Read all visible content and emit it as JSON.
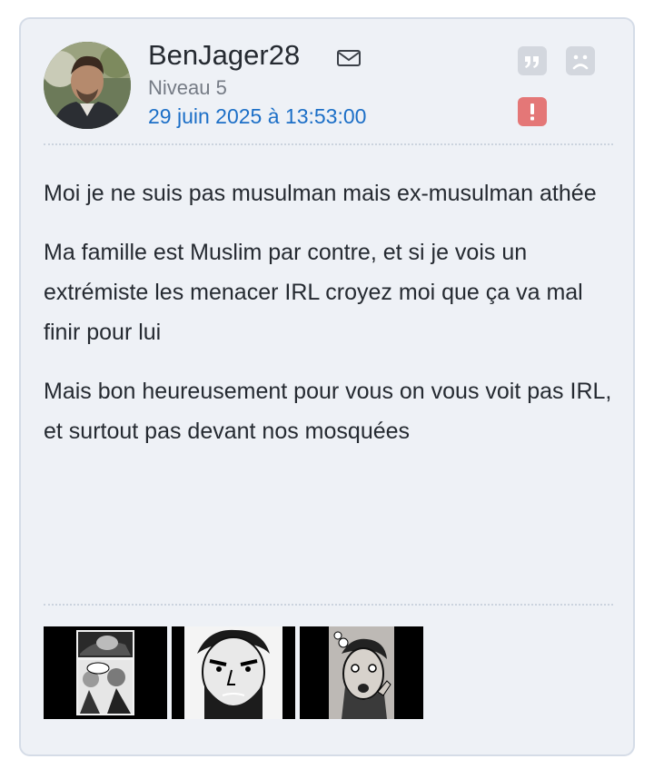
{
  "post": {
    "username": "BenJager28",
    "level": "Niveau 5",
    "date": "29 juin 2025 à 13:53:00",
    "icons": {
      "mail": "envelope-icon",
      "quote": "quote-icon",
      "dislike": "frown-icon",
      "report": "exclamation-icon"
    },
    "colors": {
      "card_background": "#eef1f6",
      "date_link": "#1c6fc7",
      "report_button": "#e47777",
      "neutral_button": "#d3d7de"
    },
    "paragraphs": [
      "Moi je ne suis pas musulman mais ex-musulman athée",
      "Ma famille est Muslim par contre, et si je vois un extrémiste les menacer IRL croyez moi que ça va mal finir pour lui",
      "Mais bon heureusement pour vous on vous voit pas IRL, et surtout pas devant nos mosquées"
    ],
    "stickers": [
      {
        "name": "comic-panels-sticker"
      },
      {
        "name": "bearded-man-sticker"
      },
      {
        "name": "surprised-man-sticker"
      }
    ]
  }
}
